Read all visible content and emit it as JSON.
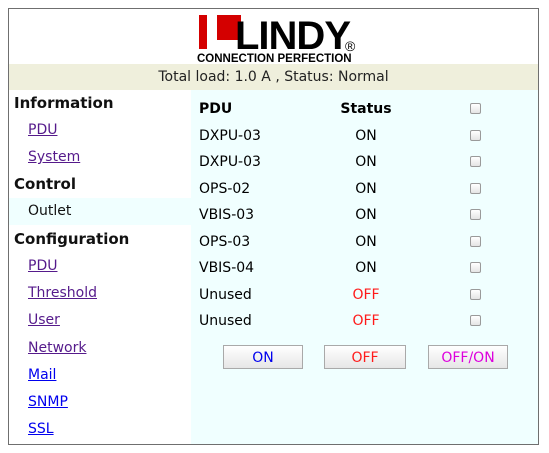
{
  "header": {
    "logo_text": "LINDY",
    "logo_tagline": "CONNECTION PERFECTION",
    "logo_registered": "®",
    "status_line": "Total load: 1.0 A , Status: Normal"
  },
  "sidebar": {
    "information": "Information",
    "info_items": [
      "PDU",
      "System"
    ],
    "control": "Control",
    "control_items": [
      "Outlet"
    ],
    "configuration": "Configuration",
    "config_items": [
      "PDU",
      "Threshold",
      "User",
      "Network",
      "Mail",
      "SNMP",
      "SSL"
    ]
  },
  "table": {
    "col_pdu": "PDU",
    "col_status": "Status",
    "rows": [
      {
        "name": "DXPU-03",
        "status": "ON"
      },
      {
        "name": "DXPU-03",
        "status": "ON"
      },
      {
        "name": "OPS-02",
        "status": "ON"
      },
      {
        "name": "VBIS-03",
        "status": "ON"
      },
      {
        "name": "OPS-03",
        "status": "ON"
      },
      {
        "name": "VBIS-04",
        "status": "ON"
      },
      {
        "name": "Unused",
        "status": "OFF"
      },
      {
        "name": "Unused",
        "status": "OFF"
      }
    ]
  },
  "buttons": {
    "on": "ON",
    "off": "OFF",
    "offon": "OFF/ON"
  },
  "colors": {
    "on_button": "#0000ee",
    "off_button": "#ff1a1a",
    "offon_button": "#dd00dd",
    "off_status": "#ff1a1a",
    "logo_red": "#d40000"
  }
}
